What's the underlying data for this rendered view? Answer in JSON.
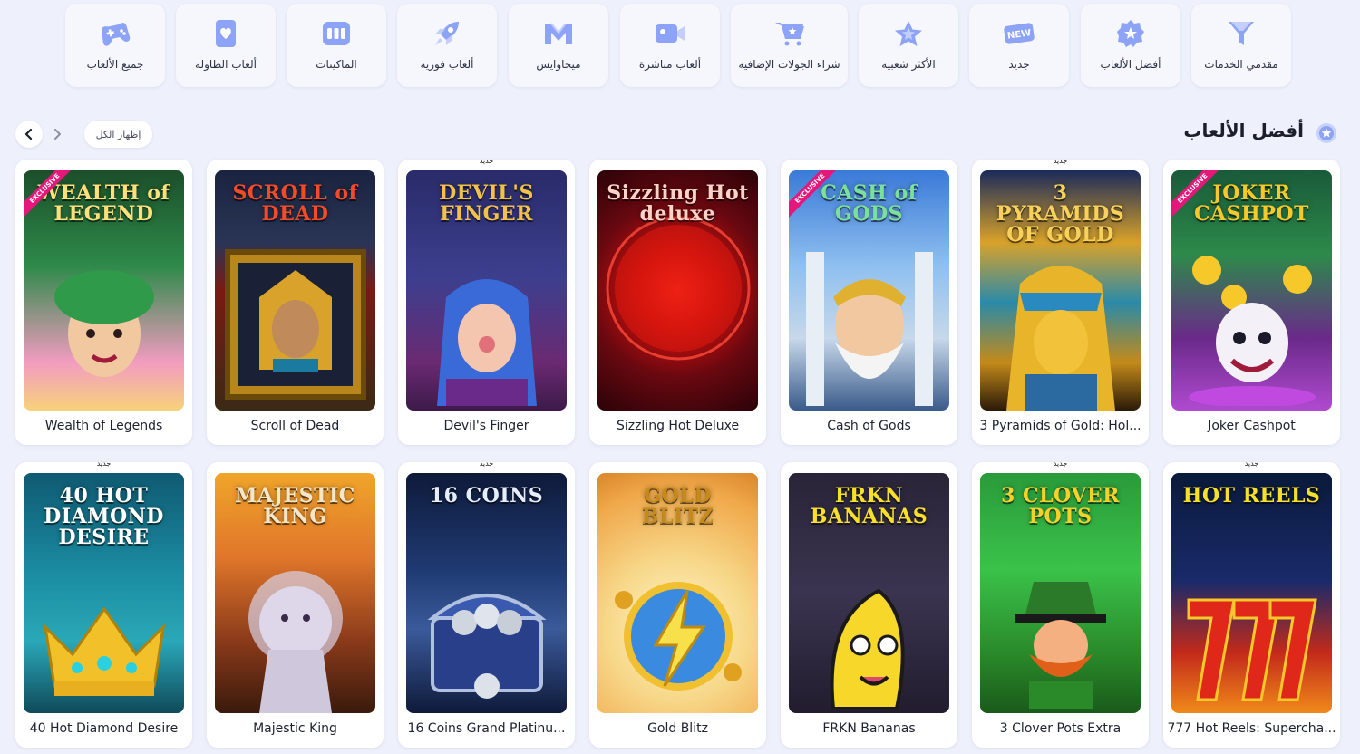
{
  "categories": [
    {
      "label": "مقدمي الخدمات",
      "icon": "funnel-icon",
      "key": "providers"
    },
    {
      "label": "أفضل الألعاب",
      "icon": "badge-star-icon",
      "key": "top"
    },
    {
      "label": "جديد",
      "icon": "new-tag-icon",
      "key": "new",
      "icon_text": "NEW"
    },
    {
      "label": "الأكثر شعبية",
      "icon": "star-icon",
      "key": "popular"
    },
    {
      "label": "شراء الجولات الإضافية",
      "icon": "cart-icon",
      "key": "bonus-buy"
    },
    {
      "label": "ألعاب مباشرة",
      "icon": "camera-icon",
      "key": "live"
    },
    {
      "label": "ميجاوايس",
      "icon": "megaways-icon",
      "key": "megaways"
    },
    {
      "label": "ألعاب فورية",
      "icon": "rocket-icon",
      "key": "instant"
    },
    {
      "label": "الماكينات",
      "icon": "slot-machine-icon",
      "key": "slots"
    },
    {
      "label": "ألعاب الطاولة",
      "icon": "card-heart-icon",
      "key": "table"
    },
    {
      "label": "جميع الألعاب",
      "icon": "gamepad-icon",
      "key": "all"
    }
  ],
  "section": {
    "title": "أفضل الألعاب",
    "show_all": "إظهار الكل",
    "icon": "badge-star-icon"
  },
  "new_badge": "جديد",
  "exclusive_badge": "EXCLUSIVE",
  "colors": {
    "accent": "#6c86f5",
    "background": "#eef1fb",
    "card": "#ffffff"
  },
  "games": [
    {
      "name": "Wealth of Legends",
      "logo": "WEALTH of LEGEND",
      "is_new": false,
      "exclusive": true,
      "bg": "linear-gradient(180deg,#1c4f2a 0%,#2e8a4a 40%,#f29cc0 80%,#f7d27a 100%)",
      "logo_color": "#ffe07a"
    },
    {
      "name": "Scroll of Dead",
      "logo": "SCROLL of DEAD",
      "is_new": false,
      "exclusive": false,
      "bg": "linear-gradient(180deg,#1a2440 0%,#2a3556 30%,#7a1a12 50%,#3a2a15 100%)",
      "logo_color": "#f34a2a"
    },
    {
      "name": "Devil's Finger",
      "logo": "DEVIL'S FINGER",
      "is_new": true,
      "exclusive": false,
      "bg": "linear-gradient(180deg,#2a2b6a 0%,#3c3f8e 45%,#6a2a72 80%,#3d1a4a 100%)",
      "logo_color": "#f2c14a"
    },
    {
      "name": "Sizzling Hot Deluxe",
      "logo": "Sizzling Hot deluxe",
      "is_new": false,
      "exclusive": false,
      "bg": "radial-gradient(circle at 50% 50%,#ff2a1a 0%,#c4100c 30%,#6a0810 60%,#2a0308 100%)",
      "logo_color": "#ffd2c8"
    },
    {
      "name": "Cash of Gods",
      "logo": "CASH of GODS",
      "is_new": false,
      "exclusive": true,
      "bg": "linear-gradient(180deg,#3a7ad8 0%,#8fc0f0 40%,#c7d8ea 70%,#3a5a8a 100%)",
      "logo_color": "#7be09a"
    },
    {
      "name": "3 Pyramids of Gold: Hol...",
      "logo": "3 PYRAMIDS OF GOLD",
      "is_new": true,
      "exclusive": false,
      "bg": "linear-gradient(180deg,#1a2a5a 0%,#d9a22a 30%,#2a8aa8 55%,#c48a1a 80%,#2a1a08 100%)",
      "logo_color": "#f7d15a"
    },
    {
      "name": "Joker Cashpot",
      "logo": "JOKER CASHPOT",
      "is_new": false,
      "exclusive": true,
      "bg": "linear-gradient(180deg,#1a5a3a 0%,#2c8a4a 35%,#6a2a8a 70%,#b04ad0 100%)",
      "logo_color": "#f7c82a"
    },
    {
      "name": "40 Hot Diamond Desire",
      "logo": "40 HOT DIAMOND DESIRE",
      "is_new": true,
      "exclusive": false,
      "bg": "linear-gradient(180deg,#0f5a72 0%,#1a8aa0 40%,#2aa8b8 70%,#0f4a5a 100%)",
      "logo_color": "#ffffff"
    },
    {
      "name": "Majestic King",
      "logo": "MAJESTIC KING",
      "is_new": false,
      "exclusive": false,
      "bg": "linear-gradient(180deg,#f0a52a 0%,#e0762a 35%,#8a3a1a 70%,#3a1a0c 100%)",
      "logo_color": "#f4e6c8"
    },
    {
      "name": "16 Coins Grand Platinu...",
      "logo": "16 COINS",
      "is_new": true,
      "exclusive": false,
      "bg": "linear-gradient(180deg,#0f1a3a 0%,#1f3a72 40%,#3a5a9a 65%,#0f1a3a 100%)",
      "logo_color": "#e6eefc"
    },
    {
      "name": "Gold Blitz",
      "logo": "GOLD BLITZ",
      "is_new": false,
      "exclusive": false,
      "bg": "radial-gradient(circle at 50% 65%,#fff3c8 0%,#f7d88a 40%,#f0a84a 80%,#d9862a 100%)",
      "logo_color": "#c78a1a"
    },
    {
      "name": "FRKN Bananas",
      "logo": "FRKN BANANAS",
      "is_new": false,
      "exclusive": false,
      "bg": "linear-gradient(180deg,#2a2438 0%,#3a3450 50%,#221c2e 100%)",
      "logo_color": "#f7e02a"
    },
    {
      "name": "3 Clover Pots Extra",
      "logo": "3 CLOVER POTS",
      "is_new": true,
      "exclusive": false,
      "bg": "linear-gradient(180deg,#2a9a3a 0%,#3ac24a 40%,#2a8a2a 75%,#1a5a1a 100%)",
      "logo_color": "#f7d02a"
    },
    {
      "name": "777 Hot Reels: Supercha...",
      "logo": "HOT REELS",
      "is_new": true,
      "exclusive": false,
      "bg": "linear-gradient(180deg,#0a1a3a 0%,#1a2a6a 45%,#c42a1a 75%,#f08a1a 100%)",
      "logo_color": "#f7e02a"
    }
  ]
}
